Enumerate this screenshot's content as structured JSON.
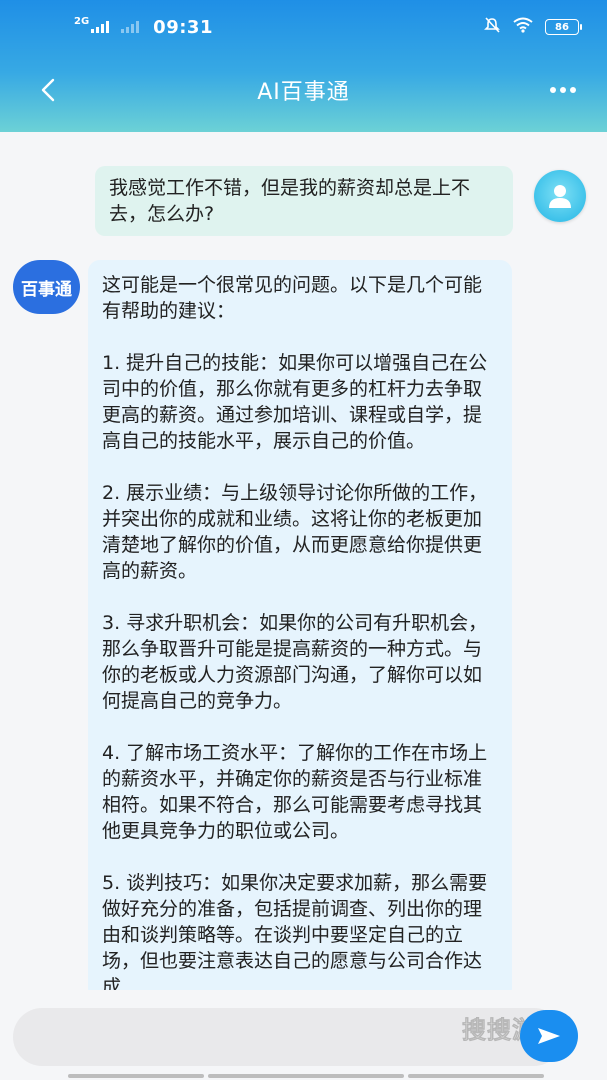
{
  "status_bar": {
    "network_label": "2G",
    "time": "09:31",
    "battery": "86"
  },
  "header": {
    "title": "AI百事通"
  },
  "user_message": {
    "text": "我感觉工作不错，但是我的薪资却总是上不去，怎么办?"
  },
  "bot": {
    "avatar_label": "百事通",
    "paragraphs": [
      "这可能是一个很常见的问题。以下是几个可能有帮助的建议：",
      "1. 提升自己的技能：如果你可以增强自己在公司中的价值，那么你就有更多的杠杆力去争取更高的薪资。通过参加培训、课程或自学，提高自己的技能水平，展示自己的价值。",
      "2. 展示业绩：与上级领导讨论你所做的工作，并突出你的成就和业绩。这将让你的老板更加清楚地了解你的价值，从而更愿意给你提供更高的薪资。",
      "3. 寻求升职机会：如果你的公司有升职机会，那么争取晋升可能是提高薪资的一种方式。与你的老板或人力资源部门沟通，了解你可以如何提高自己的竞争力。",
      "4. 了解市场工资水平：了解你的工作在市场上的薪资水平，并确定你的薪资是否与行业标准相符。如果不符合，那么可能需要考虑寻找其他更具竞争力的职位或公司。",
      "5. 谈判技巧：如果你决定要求加薪，那么需要做好充分的准备，包括提前调查、列出你的理由和谈判策略等。在谈判中要坚定自己的立场，但也要注意表达自己的愿意与公司合作达成"
    ]
  },
  "input": {
    "value": ""
  },
  "watermark": "搜搜游戏",
  "colors": {
    "header_top": "#1f8fe6",
    "header_bottom": "#6cd1d6",
    "user_bubble": "#dff3ef",
    "bot_bubble": "#e6f4fd",
    "bot_avatar": "#2b6fe0",
    "send_button": "#1a8ef0"
  },
  "icons": {
    "back": "chevron-left-icon",
    "more": "more-dots-icon",
    "send": "send-arrow-icon",
    "user_avatar": "person-icon"
  }
}
